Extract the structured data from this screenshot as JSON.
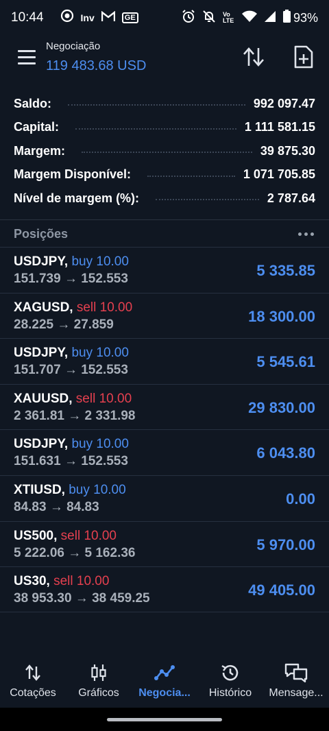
{
  "status_bar": {
    "time": "10:44",
    "left_icons": [
      "target-icon",
      "inv-icon",
      "gmail-icon",
      "ge-icon"
    ],
    "inv_label": "Inv",
    "ge_label": "GE",
    "right_icons": [
      "alarm-icon",
      "mute-icon",
      "volte-icon",
      "wifi-icon",
      "signal-icon",
      "battery-icon"
    ],
    "volte_label": "Vo LTE",
    "battery": "93%"
  },
  "header": {
    "title": "Negociação",
    "balance": "119 483.68 USD"
  },
  "summary": [
    {
      "label": "Saldo:",
      "value": "992 097.47"
    },
    {
      "label": "Capital:",
      "value": "1 111 581.15"
    },
    {
      "label": "Margem:",
      "value": "39 875.30"
    },
    {
      "label": "Margem Disponível:",
      "value": "1 071 705.85"
    },
    {
      "label": "Nível de margem (%):",
      "value": "2 787.64"
    }
  ],
  "positions_section": {
    "title": "Posições"
  },
  "positions": [
    {
      "symbol": "USDJPY,",
      "side": "buy 10.00",
      "prices": "151.739 → 152.553",
      "profit": "5 335.85",
      "type": "buy"
    },
    {
      "symbol": "XAGUSD,",
      "side": "sell 10.00",
      "prices": "28.225 → 27.859",
      "profit": "18 300.00",
      "type": "sell"
    },
    {
      "symbol": "USDJPY,",
      "side": "buy 10.00",
      "prices": "151.707 → 152.553",
      "profit": "5 545.61",
      "type": "buy"
    },
    {
      "symbol": "XAUUSD,",
      "side": "sell 10.00",
      "prices": "2 361.81 → 2 331.98",
      "profit": "29 830.00",
      "type": "sell"
    },
    {
      "symbol": "USDJPY,",
      "side": "buy 10.00",
      "prices": "151.631 → 152.553",
      "profit": "6 043.80",
      "type": "buy"
    },
    {
      "symbol": "XTIUSD,",
      "side": "buy 10.00",
      "prices": "84.83 → 84.83",
      "profit": "0.00",
      "type": "buy"
    },
    {
      "symbol": "US500,",
      "side": "sell 10.00",
      "prices": "5 222.06 → 5 162.36",
      "profit": "5 970.00",
      "type": "sell"
    },
    {
      "symbol": "US30,",
      "side": "sell 10.00",
      "prices": "38 953.30 → 38 459.25",
      "profit": "49 405.00",
      "type": "sell"
    }
  ],
  "bottom_nav": [
    {
      "label": "Cotações",
      "icon": "quotes-icon",
      "active": false
    },
    {
      "label": "Gráficos",
      "icon": "charts-icon",
      "active": false
    },
    {
      "label": "Negocia...",
      "icon": "trade-icon",
      "active": true
    },
    {
      "label": "Histórico",
      "icon": "history-icon",
      "active": false
    },
    {
      "label": "Mensage...",
      "icon": "messages-icon",
      "active": false
    }
  ],
  "colors": {
    "background": "#101722",
    "accent_blue": "#4d8ef0",
    "sell_red": "#e5404f",
    "muted_text": "#a9b0ba"
  }
}
